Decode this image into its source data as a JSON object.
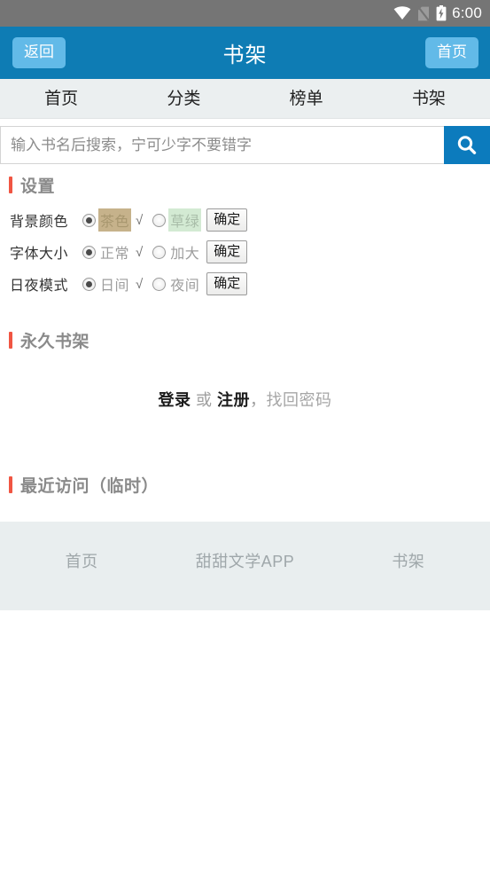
{
  "status_bar": {
    "time": "6:00",
    "icons": [
      "wifi-icon",
      "no-sim-icon",
      "battery-charging-icon"
    ],
    "background": "#757575"
  },
  "app_bar": {
    "back_label": "返回",
    "title": "书架",
    "home_label": "首页",
    "background": "#0e7cb4",
    "button_background": "#62bae8"
  },
  "nav_tabs": [
    {
      "label": "首页"
    },
    {
      "label": "分类"
    },
    {
      "label": "榜单"
    },
    {
      "label": "书架"
    }
  ],
  "search": {
    "value": "",
    "placeholder": "输入书名后搜索，宁可少字不要错字",
    "button_icon": "search-icon",
    "button_background": "#0c7bbd"
  },
  "settings": {
    "heading": "设置",
    "accent_color": "#f05542",
    "rows": [
      {
        "label": "背景颜色",
        "option_a": "茶色",
        "option_b": "草绿",
        "selected": "option_a",
        "check": "√",
        "confirm": "确定",
        "option_a_bg": "#c6b28b",
        "option_b_bg": "#d3ead3"
      },
      {
        "label": "字体大小",
        "option_a": "正常",
        "option_b": "加大",
        "selected": "option_a",
        "check": "√",
        "confirm": "确定"
      },
      {
        "label": "日夜模式",
        "option_a": "日间",
        "option_b": "夜间",
        "selected": "option_a",
        "check": "√",
        "confirm": "确定"
      }
    ]
  },
  "permanent_shelf": {
    "heading": "永久书架",
    "login": "登录",
    "or": "或",
    "register": "注册",
    "comma": "，",
    "forgot": "找回密码"
  },
  "recent": {
    "heading": "最近访问（临时）"
  },
  "footer": {
    "items": [
      {
        "label": "首页"
      },
      {
        "label": "甜甜文学APP"
      },
      {
        "label": "书架"
      }
    ],
    "background": "#e9eeef"
  }
}
